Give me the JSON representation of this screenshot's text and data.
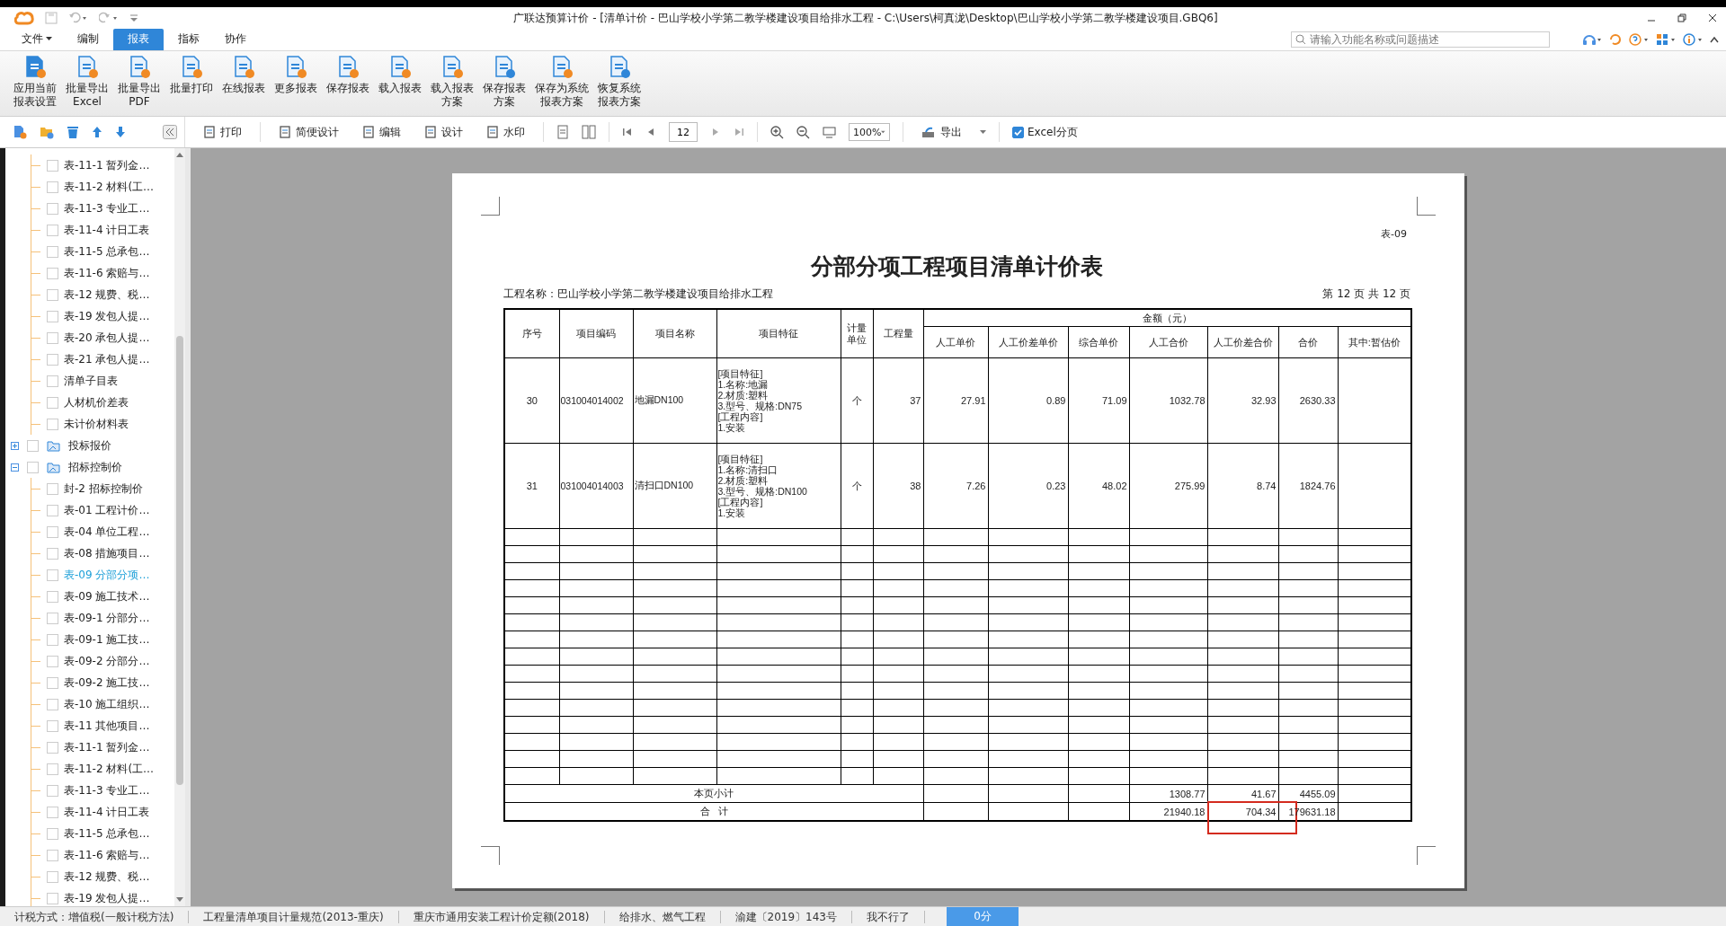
{
  "window": {
    "title": "广联达预算计价 - [清单计价 - 巴山学校小学第二教学楼建设项目给排水工程 - C:\\Users\\柯真泷\\Desktop\\巴山学校小学第二教学楼建设项目.GBQ6]"
  },
  "menu": {
    "tabs": [
      {
        "label": "文件",
        "dropdown": true,
        "selected": false
      },
      {
        "label": "编制",
        "dropdown": false,
        "selected": false
      },
      {
        "label": "报表",
        "dropdown": false,
        "selected": true
      },
      {
        "label": "指标",
        "dropdown": false,
        "selected": false
      },
      {
        "label": "协作",
        "dropdown": false,
        "selected": false
      }
    ]
  },
  "search": {
    "placeholder": "请输入功能名称或问题描述"
  },
  "ribbon": {
    "buttons": [
      {
        "lines": [
          "应用当前",
          "报表设置"
        ]
      },
      {
        "lines": [
          "批量导出",
          "Excel"
        ]
      },
      {
        "lines": [
          "批量导出",
          "PDF"
        ]
      },
      {
        "lines": [
          "批量打印"
        ]
      },
      {
        "lines": [
          "在线报表"
        ]
      },
      {
        "lines": [
          "更多报表"
        ]
      },
      {
        "lines": [
          "保存报表"
        ]
      },
      {
        "lines": [
          "载入报表"
        ]
      },
      {
        "lines": [
          "载入报表",
          "方案"
        ]
      },
      {
        "lines": [
          "保存报表",
          "方案"
        ]
      },
      {
        "lines": [
          "保存为系统",
          "报表方案"
        ]
      },
      {
        "lines": [
          "恢复系统",
          "报表方案"
        ]
      }
    ]
  },
  "toolbar": {
    "buttons": [
      "打印",
      "简便设计",
      "编辑",
      "设计",
      "水印"
    ],
    "page": "12",
    "zoom": "100%",
    "export": "导出",
    "excel_paging": {
      "label": "Excel分页",
      "checked": true
    }
  },
  "sidebar": {
    "continued_items": [
      {
        "label": "表-11-1 暂列金…",
        "checked": false,
        "selected": false
      },
      {
        "label": "表-11-2 材料(工…",
        "checked": false,
        "selected": false
      },
      {
        "label": "表-11-3 专业工…",
        "checked": false,
        "selected": false
      },
      {
        "label": "表-11-4 计日工表",
        "checked": false,
        "selected": false
      },
      {
        "label": "表-11-5 总承包…",
        "checked": false,
        "selected": false
      },
      {
        "label": "表-11-6 索赔与…",
        "checked": false,
        "selected": false
      },
      {
        "label": "表-12 规费、税…",
        "checked": false,
        "selected": false
      },
      {
        "label": "表-19 发包人提…",
        "checked": false,
        "selected": false
      },
      {
        "label": "表-20 承包人提…",
        "checked": false,
        "selected": false
      },
      {
        "label": "表-21 承包人提…",
        "checked": false,
        "selected": false
      },
      {
        "label": "清单子目表",
        "checked": false,
        "selected": false
      },
      {
        "label": "人材机价差表",
        "checked": false,
        "selected": false
      },
      {
        "label": "未计价材料表",
        "checked": false,
        "selected": false
      }
    ],
    "items": [
      {
        "label": "投标报价",
        "checked": false,
        "expanded": false
      },
      {
        "label": "招标控制价",
        "checked": false,
        "expanded": true,
        "children": [
          {
            "label": "封-2 招标控制价",
            "checked": false,
            "selected": false
          },
          {
            "label": "表-01 工程计价…",
            "checked": false,
            "selected": false
          },
          {
            "label": "表-04 单位工程…",
            "checked": false,
            "selected": false
          },
          {
            "label": "表-08 措施项目…",
            "checked": false,
            "selected": false
          },
          {
            "label": "表-09 分部分项…",
            "checked": false,
            "selected": true
          },
          {
            "label": "表-09 施工技术…",
            "checked": false,
            "selected": false
          },
          {
            "label": "表-09-1 分部分…",
            "checked": false,
            "selected": false
          },
          {
            "label": "表-09-1 施工技…",
            "checked": false,
            "selected": false
          },
          {
            "label": "表-09-2 分部分…",
            "checked": false,
            "selected": false
          },
          {
            "label": "表-09-2 施工技…",
            "checked": false,
            "selected": false
          },
          {
            "label": "表-10 施工组织…",
            "checked": false,
            "selected": false
          },
          {
            "label": "表-11 其他项目…",
            "checked": false,
            "selected": false
          },
          {
            "label": "表-11-1 暂列金…",
            "checked": false,
            "selected": false
          },
          {
            "label": "表-11-2 材料(工…",
            "checked": false,
            "selected": false
          },
          {
            "label": "表-11-3 专业工…",
            "checked": false,
            "selected": false
          },
          {
            "label": "表-11-4 计日工表",
            "checked": false,
            "selected": false
          },
          {
            "label": "表-11-5 总承包…",
            "checked": false,
            "selected": false
          },
          {
            "label": "表-11-6 索赔与…",
            "checked": false,
            "selected": false
          },
          {
            "label": "表-12 规费、税…",
            "checked": false,
            "selected": false
          },
          {
            "label": "表-19 发包人提…",
            "checked": false,
            "selected": false
          }
        ]
      }
    ]
  },
  "report": {
    "form_code": "表-09",
    "title": "分部分项工程项目清单计价表",
    "project": "工程名称：巴山学校小学第二教学楼建设项目给排水工程",
    "page_info": "第 12 页 共 12 页",
    "columns": [
      "序号",
      "项目编码",
      "项目名称",
      "项目特征",
      "计量单位",
      "工程量"
    ],
    "amount_group": "金额（元）",
    "amount_columns": [
      "人工单价",
      "人工价差单价",
      "综合单价",
      "人工合价",
      "人工价差合价",
      "合价",
      "其中:暂估价"
    ],
    "rows": [
      {
        "seq": "30",
        "code": "031004014002",
        "name": "地漏DN100",
        "features": [
          "[项目特征]",
          "1.名称:地漏",
          "2.材质:塑料",
          "3.型号、规格:DN75",
          "[工程内容]",
          "1.安装"
        ],
        "unit": "个",
        "quantity": "37",
        "amounts": [
          "27.91",
          "0.89",
          "71.09",
          "1032.78",
          "32.93",
          "2630.33"
        ]
      },
      {
        "seq": "31",
        "code": "031004014003",
        "name": "清扫口DN100",
        "features": [
          "[项目特征]",
          "1.名称:清扫口",
          "2.材质:塑料",
          "3.型号、规格:DN100",
          "[工程内容]",
          "1.安装"
        ],
        "unit": "个",
        "quantity": "38",
        "amounts": [
          "7.26",
          "0.23",
          "48.02",
          "275.99",
          "8.74",
          "1824.76"
        ]
      }
    ],
    "summary": [
      {
        "label": "本页小计",
        "amounts": [
          {
            "text": "1308.77",
            "highlighted": false
          },
          {
            "text": "41.67",
            "highlighted": false
          },
          {
            "text": "4455.09",
            "highlighted": false
          }
        ]
      },
      {
        "label": "合   计",
        "amounts": [
          {
            "text": "21940.18",
            "highlighted": false
          },
          {
            "text": "704.34",
            "highlighted": true
          },
          {
            "text": "179631.18",
            "highlighted": false
          }
        ]
      }
    ]
  },
  "status_bar": {
    "items": [
      {
        "text": "计税方式：增值税(一般计税方法)",
        "kind": "text"
      },
      {
        "text": "工程量清单项目计量规范(2013-重庆)",
        "kind": "text"
      },
      {
        "text": "重庆市通用安装工程计价定额(2018)",
        "kind": "text"
      },
      {
        "text": "给排水、燃气工程",
        "kind": "text"
      },
      {
        "text": "渝建〔2019〕143号",
        "kind": "text"
      },
      {
        "text": "我不行了",
        "kind": "text"
      },
      {
        "text": "0分",
        "kind": "badge"
      }
    ]
  }
}
